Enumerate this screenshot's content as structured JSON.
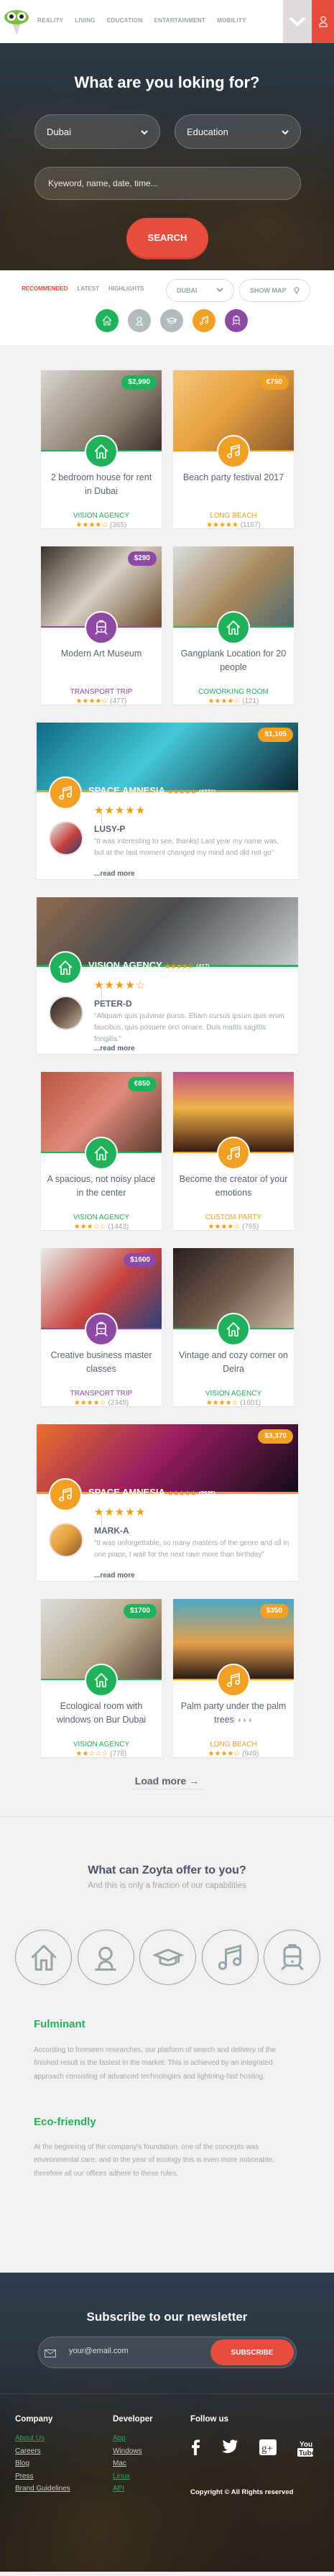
{
  "header": {
    "nav": [
      "REALITY",
      "LIVING",
      "EDUCATION",
      "ENTARTAINMENT",
      "MOBILITY"
    ]
  },
  "hero": {
    "title": "What are you loking for?",
    "city_value": "Dubai",
    "category_value": "Education",
    "keyword_placeholder": "Kyeword, name, date, time...",
    "search_label": "SEARCH"
  },
  "filters": {
    "tabs": [
      "RECOMMENDED",
      "LATEST",
      "HIGHLIGHTS"
    ],
    "city": "DUBAI",
    "show_map": "SHOW MAP",
    "categories": [
      {
        "icon": "house",
        "color": "#1fb25a"
      },
      {
        "icon": "person",
        "color": "#b3bcbc"
      },
      {
        "icon": "graduation-cap",
        "color": "#b3bcbc"
      },
      {
        "icon": "music",
        "color": "#f1a025"
      },
      {
        "icon": "train",
        "color": "#8e4aa3"
      }
    ]
  },
  "colors": {
    "green": "#1fb25a",
    "orange": "#f1a025",
    "purple": "#8e4aa3",
    "red": "#e74c3c"
  },
  "feed": [
    {
      "type": "pair",
      "cards": [
        {
          "price": "$2,990",
          "icon": "house",
          "color": "green",
          "title": "2 bedroom house for rent in Dubai",
          "agency": "VISION AGENCY",
          "rating": 4,
          "count": "(365)"
        },
        {
          "price": "€750",
          "icon": "music",
          "color": "orange",
          "title": "Beach party festival 2017",
          "agency": "LONG BEACH",
          "rating": 5,
          "count": "(1167)"
        }
      ]
    },
    {
      "type": "pair",
      "cards": [
        {
          "price": "$290",
          "icon": "train",
          "color": "purple",
          "title": "Modern Art Museum",
          "agency": "TRANSPORT TRIP",
          "rating": 4,
          "count": "(477)"
        },
        {
          "price": "",
          "icon": "house",
          "color": "green",
          "title": "Gangplank Location for 20 people",
          "agency": "COWORKING ROOM",
          "rating": 4,
          "count": "(121)"
        }
      ]
    },
    {
      "type": "review",
      "price": "$1,105",
      "icon": "music",
      "color": "orange",
      "name": "SPACE AMNESIA",
      "rating": 5,
      "count": "(4321)",
      "review_rating": 5,
      "reviewer": "LUSY-P",
      "text": "“It was interesting to see, thanks! Last year my name was, but at the last moment changed my mind and did not go”",
      "more": "...read more"
    },
    {
      "type": "review",
      "price": "",
      "icon": "house",
      "color": "green",
      "name": "VISION AGENCY",
      "rating": 4,
      "count": "(417)",
      "review_rating": 4,
      "reviewer": "PETER-D",
      "text": "“Aliquam quis pulvinar purus. Etiam cursus ipsum quis enim faucibus, quis posuere orci ornare. Duis mattis sagittis fringilla.”",
      "more": "...read more"
    },
    {
      "type": "pair",
      "cards": [
        {
          "price": "€650",
          "icon": "house",
          "color": "green",
          "title": "A spacious, not noisy place in the center",
          "agency": "VISION AGENCY",
          "rating": 3,
          "count": "(1443)"
        },
        {
          "price": "",
          "icon": "music",
          "color": "orange",
          "title": "Become the creator of your emotions",
          "agency": "CUSTOM PARTY",
          "rating": 4,
          "count": "(765)"
        }
      ]
    },
    {
      "type": "pair",
      "cards": [
        {
          "price": "$1600",
          "icon": "train",
          "color": "purple",
          "title": "Creative business master classes",
          "agency": "TRANSPORT TRIP",
          "rating": 4,
          "count": "(2345)"
        },
        {
          "price": "",
          "icon": "house",
          "color": "green",
          "title": "Vintage and cozy corner on Deira",
          "agency": "VISION AGENCY",
          "rating": 4,
          "count": "(1601)"
        }
      ]
    },
    {
      "type": "review",
      "price": "$3,370",
      "icon": "music",
      "color": "orange",
      "name": "SPACE AMNESIA",
      "rating": 5,
      "count": "(2525)",
      "review_rating": 5,
      "reviewer": "MARK-A",
      "text": "“It was unforgettable, so many masters of the genre and all in one place, I wait for the next rave more than birthday”",
      "more": "...read more"
    },
    {
      "type": "pair",
      "cards": [
        {
          "price": "$1700",
          "icon": "house",
          "color": "green",
          "title": "Ecological room with windows on Bur Dubai",
          "agency": "VISION AGENCY",
          "rating": 2,
          "count": "(778)"
        },
        {
          "price": "$350",
          "icon": "music",
          "color": "orange",
          "title": "Palm party under the palm trees ⍖⍖⍖",
          "agency": "LONG BEACH",
          "rating": 4,
          "count": "(949)"
        }
      ]
    }
  ],
  "load_more": "Load more →",
  "offer": {
    "title": "What can Zoyta offer to you?",
    "subtitle": "And this is only a fraction of our capabilities",
    "icons": [
      "house",
      "person",
      "graduation-cap",
      "music",
      "train"
    ],
    "features": [
      {
        "title": "Fulminant",
        "text": "According to foreseen researches, our platform of search and delivery of the finished result is the fastest in the market. This is achieved by an integrated approach consisting of advanced technologies and lightning-fast hosting."
      },
      {
        "title": "Eco-friendly",
        "text": "At the beginning of the company's foundation, one of the concepts was environmental care, and in the year of ecology this is even more noticeable, therefore all our offices adhere to these rules."
      }
    ]
  },
  "newsletter": {
    "title": "Subscribe to our newsletter",
    "email_placeholder": "your@email.com",
    "button": "SUBSCRIBE"
  },
  "footer": {
    "company_title": "Company",
    "company_links": [
      "About Us",
      "Careers",
      "Blog",
      "Press",
      "Brand Guidelines"
    ],
    "developer_title": "Developer",
    "developer_links": [
      "App",
      "Windows",
      "Mac",
      "Linux",
      "API"
    ],
    "follow_title": "Follow us",
    "social": [
      "facebook",
      "twitter",
      "google-plus",
      "youtube"
    ],
    "copyright": "Copyright © All Rights reserved"
  }
}
